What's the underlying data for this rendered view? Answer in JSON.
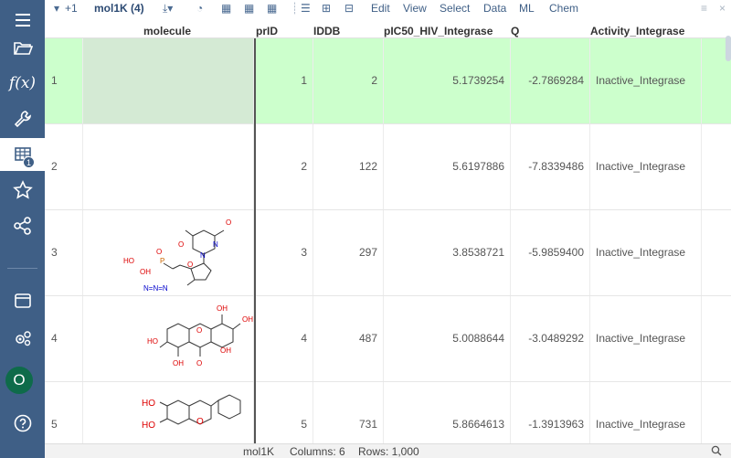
{
  "toolbar": {
    "dropdown_label": "+1",
    "table_title": "mol1K (4)",
    "menus": [
      "Edit",
      "View",
      "Select",
      "Data",
      "ML",
      "Chem"
    ]
  },
  "sidebar": {
    "items": [
      {
        "icon": "menu-icon"
      },
      {
        "icon": "folder-open-icon"
      },
      {
        "icon": "function-icon",
        "label": "f(x)"
      },
      {
        "icon": "wrench-icon"
      },
      {
        "icon": "table-icon",
        "badge": "1"
      },
      {
        "icon": "star-icon"
      },
      {
        "icon": "share-icon"
      },
      {
        "icon": "window-icon"
      },
      {
        "icon": "settings-icon"
      },
      {
        "icon": "user-avatar",
        "label": "O"
      },
      {
        "icon": "help-icon",
        "label": "?"
      }
    ]
  },
  "grid": {
    "columns": [
      "molecule",
      "prID",
      "IDDB",
      "pIC50_HIV_Integrase",
      "Q",
      "Activity_Integrase"
    ],
    "rows": [
      {
        "n": "1",
        "prID": "1",
        "IDDB": "2",
        "pIC50": "5.1739254",
        "Q": "-2.7869284",
        "activity": "Inactive_Integrase"
      },
      {
        "n": "2",
        "prID": "2",
        "IDDB": "122",
        "pIC50": "5.6197886",
        "Q": "-7.8339486",
        "activity": "Inactive_Integrase"
      },
      {
        "n": "3",
        "prID": "3",
        "IDDB": "297",
        "pIC50": "3.8538721",
        "Q": "-5.9859400",
        "activity": "Inactive_Integrase"
      },
      {
        "n": "4",
        "prID": "4",
        "IDDB": "487",
        "pIC50": "5.0088644",
        "Q": "-3.0489292",
        "activity": "Inactive_Integrase"
      },
      {
        "n": "5",
        "prID": "5",
        "IDDB": "731",
        "pIC50": "5.8664613",
        "Q": "-1.3913963",
        "activity": "Inactive_Integrase"
      }
    ]
  },
  "molecule_labels": {
    "row3": [
      "O",
      "N",
      "N",
      "O",
      "P",
      "HO",
      "OH",
      "O",
      "O",
      "N=N=N"
    ],
    "row4": [
      "OH",
      "OH",
      "HO",
      "O",
      "OH",
      "OH",
      "O"
    ],
    "row5": [
      "HO",
      "HO",
      "O"
    ]
  },
  "status": {
    "table": "mol1K",
    "columns": "Columns: 6",
    "rows": "Rows: 1,000"
  }
}
